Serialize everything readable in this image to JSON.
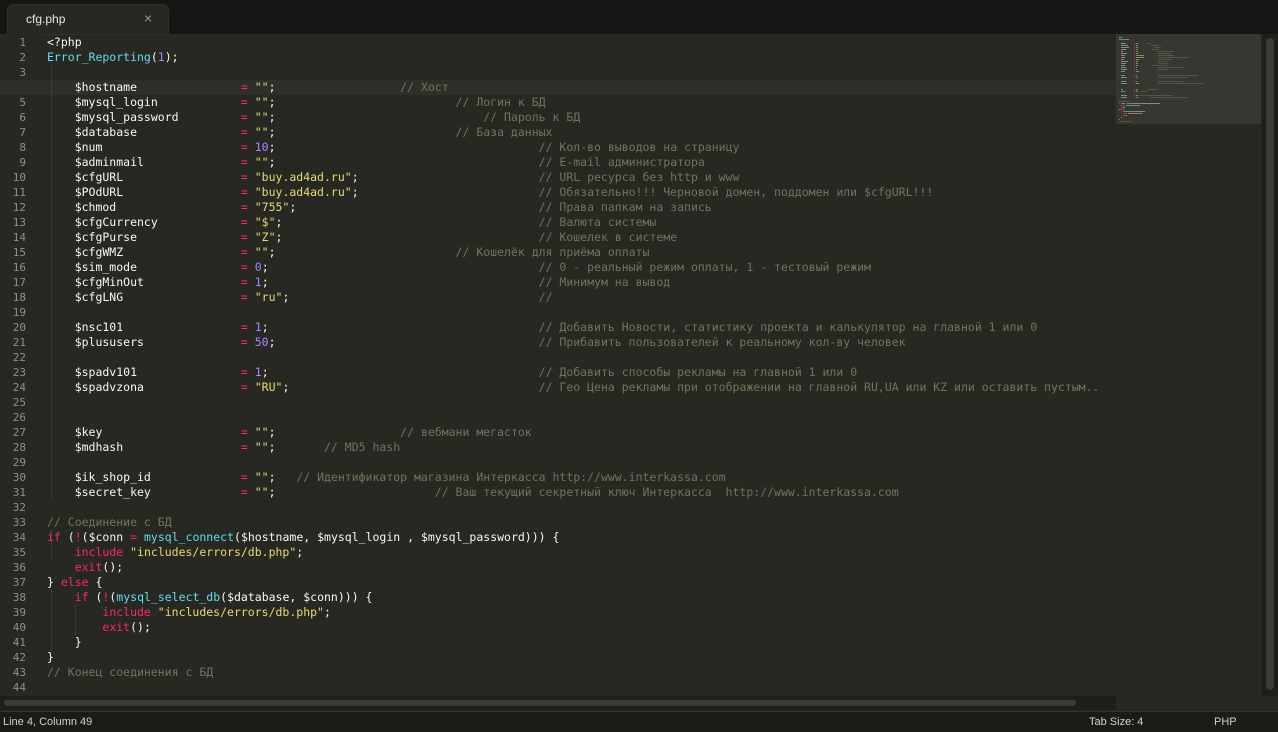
{
  "tab": {
    "title": "cfg.php",
    "close_glyph": "×"
  },
  "status": {
    "position": "Line 4, Column 49",
    "tab_size": "Tab Size: 4",
    "syntax": "PHP"
  },
  "active_line": 4,
  "lines": [
    [
      {
        "t": "<?php",
        "c": "v"
      }
    ],
    [
      {
        "t": "Error_Reporting",
        "c": "f"
      },
      {
        "t": "(",
        "c": "v"
      },
      {
        "t": "1",
        "c": "n"
      },
      {
        "t": ");",
        "c": "v"
      }
    ],
    [],
    [
      {
        "t": "    $hostname               ",
        "c": "v"
      },
      {
        "t": "=",
        "c": "k"
      },
      {
        "t": " ",
        "c": "v"
      },
      {
        "t": "\"\"",
        "c": "s"
      },
      {
        "t": ";                  ",
        "c": "v"
      },
      {
        "t": "// Хост",
        "c": "c"
      }
    ],
    [
      {
        "t": "    $mysql_login            ",
        "c": "v"
      },
      {
        "t": "=",
        "c": "k"
      },
      {
        "t": " ",
        "c": "v"
      },
      {
        "t": "\"\"",
        "c": "s"
      },
      {
        "t": ";                          ",
        "c": "v"
      },
      {
        "t": "// Логин к БД",
        "c": "c"
      }
    ],
    [
      {
        "t": "    $mysql_password         ",
        "c": "v"
      },
      {
        "t": "=",
        "c": "k"
      },
      {
        "t": " ",
        "c": "v"
      },
      {
        "t": "\"\"",
        "c": "s"
      },
      {
        "t": ";                              ",
        "c": "v"
      },
      {
        "t": "// Пароль к БД",
        "c": "c"
      }
    ],
    [
      {
        "t": "    $database               ",
        "c": "v"
      },
      {
        "t": "=",
        "c": "k"
      },
      {
        "t": " ",
        "c": "v"
      },
      {
        "t": "\"\"",
        "c": "s"
      },
      {
        "t": ";                          ",
        "c": "v"
      },
      {
        "t": "// База данных",
        "c": "c"
      }
    ],
    [
      {
        "t": "    $num                    ",
        "c": "v"
      },
      {
        "t": "=",
        "c": "k"
      },
      {
        "t": " ",
        "c": "v"
      },
      {
        "t": "10",
        "c": "n"
      },
      {
        "t": ";                                      ",
        "c": "v"
      },
      {
        "t": "// Кол-во выводов на страницу",
        "c": "c"
      }
    ],
    [
      {
        "t": "    $adminmail              ",
        "c": "v"
      },
      {
        "t": "=",
        "c": "k"
      },
      {
        "t": " ",
        "c": "v"
      },
      {
        "t": "\"\"",
        "c": "s"
      },
      {
        "t": ";                                      ",
        "c": "v"
      },
      {
        "t": "// E-mail администратора",
        "c": "c"
      }
    ],
    [
      {
        "t": "    $cfgURL                 ",
        "c": "v"
      },
      {
        "t": "=",
        "c": "k"
      },
      {
        "t": " ",
        "c": "v"
      },
      {
        "t": "\"buy.ad4ad.ru\"",
        "c": "s"
      },
      {
        "t": ";                          ",
        "c": "v"
      },
      {
        "t": "// URL ресурса без http и www",
        "c": "c"
      }
    ],
    [
      {
        "t": "    $POdURL                 ",
        "c": "v"
      },
      {
        "t": "=",
        "c": "k"
      },
      {
        "t": " ",
        "c": "v"
      },
      {
        "t": "\"buy.ad4ad.ru\"",
        "c": "s"
      },
      {
        "t": ";                          ",
        "c": "v"
      },
      {
        "t": "// Обязательно!!! Черновой домен, поддомен или $cfgURL!!!",
        "c": "c"
      }
    ],
    [
      {
        "t": "    $chmod                  ",
        "c": "v"
      },
      {
        "t": "=",
        "c": "k"
      },
      {
        "t": " ",
        "c": "v"
      },
      {
        "t": "\"755\"",
        "c": "s"
      },
      {
        "t": ";                                   ",
        "c": "v"
      },
      {
        "t": "// Права папкам на запись",
        "c": "c"
      }
    ],
    [
      {
        "t": "    $cfgCurrency            ",
        "c": "v"
      },
      {
        "t": "=",
        "c": "k"
      },
      {
        "t": " ",
        "c": "v"
      },
      {
        "t": "\"$\"",
        "c": "s"
      },
      {
        "t": ";                                     ",
        "c": "v"
      },
      {
        "t": "// Валюта системы",
        "c": "c"
      }
    ],
    [
      {
        "t": "    $cfgPurse               ",
        "c": "v"
      },
      {
        "t": "=",
        "c": "k"
      },
      {
        "t": " ",
        "c": "v"
      },
      {
        "t": "\"Z\"",
        "c": "s"
      },
      {
        "t": ";                                     ",
        "c": "v"
      },
      {
        "t": "// Кошелек в системе",
        "c": "c"
      }
    ],
    [
      {
        "t": "    $cfgWMZ                 ",
        "c": "v"
      },
      {
        "t": "=",
        "c": "k"
      },
      {
        "t": " ",
        "c": "v"
      },
      {
        "t": "\"\"",
        "c": "s"
      },
      {
        "t": ";                          ",
        "c": "v"
      },
      {
        "t": "// Кошелёк для приёма оплаты",
        "c": "c"
      }
    ],
    [
      {
        "t": "    $sim_mode               ",
        "c": "v"
      },
      {
        "t": "=",
        "c": "k"
      },
      {
        "t": " ",
        "c": "v"
      },
      {
        "t": "0",
        "c": "n"
      },
      {
        "t": ";                                       ",
        "c": "v"
      },
      {
        "t": "// 0 - реальный режим оплаты, 1 - тестовый режим",
        "c": "c"
      }
    ],
    [
      {
        "t": "    $cfgMinOut              ",
        "c": "v"
      },
      {
        "t": "=",
        "c": "k"
      },
      {
        "t": " ",
        "c": "v"
      },
      {
        "t": "1",
        "c": "n"
      },
      {
        "t": ";                                       ",
        "c": "v"
      },
      {
        "t": "// Минимум на вывод",
        "c": "c"
      }
    ],
    [
      {
        "t": "    $cfgLNG                 ",
        "c": "v"
      },
      {
        "t": "=",
        "c": "k"
      },
      {
        "t": " ",
        "c": "v"
      },
      {
        "t": "\"ru\"",
        "c": "s"
      },
      {
        "t": ";                                    ",
        "c": "v"
      },
      {
        "t": "//",
        "c": "c"
      }
    ],
    [],
    [
      {
        "t": "    $nsc101                 ",
        "c": "v"
      },
      {
        "t": "=",
        "c": "k"
      },
      {
        "t": " ",
        "c": "v"
      },
      {
        "t": "1",
        "c": "n"
      },
      {
        "t": ";                                       ",
        "c": "v"
      },
      {
        "t": "// Добавить Новости, статистику проекта и калькулятор на главной 1 или 0",
        "c": "c"
      }
    ],
    [
      {
        "t": "    $plususers              ",
        "c": "v"
      },
      {
        "t": "=",
        "c": "k"
      },
      {
        "t": " ",
        "c": "v"
      },
      {
        "t": "50",
        "c": "n"
      },
      {
        "t": ";                                      ",
        "c": "v"
      },
      {
        "t": "// Прибавить пользователей к реальному кол-ву человек",
        "c": "c"
      }
    ],
    [],
    [
      {
        "t": "    $spadv101               ",
        "c": "v"
      },
      {
        "t": "=",
        "c": "k"
      },
      {
        "t": " ",
        "c": "v"
      },
      {
        "t": "1",
        "c": "n"
      },
      {
        "t": ";                                       ",
        "c": "v"
      },
      {
        "t": "// Добавить способы рекламы на главной 1 или 0",
        "c": "c"
      }
    ],
    [
      {
        "t": "    $spadvzona              ",
        "c": "v"
      },
      {
        "t": "=",
        "c": "k"
      },
      {
        "t": " ",
        "c": "v"
      },
      {
        "t": "\"RU\"",
        "c": "s"
      },
      {
        "t": ";                                    ",
        "c": "v"
      },
      {
        "t": "// Гео Цена рекламы при отображении на главной RU,UA или KZ или оставить пустым..",
        "c": "c"
      }
    ],
    [],
    [],
    [
      {
        "t": "    $key                    ",
        "c": "v"
      },
      {
        "t": "=",
        "c": "k"
      },
      {
        "t": " ",
        "c": "v"
      },
      {
        "t": "\"\"",
        "c": "s"
      },
      {
        "t": ";                  ",
        "c": "v"
      },
      {
        "t": "// вебмани мегасток",
        "c": "c"
      }
    ],
    [
      {
        "t": "    $mdhash                 ",
        "c": "v"
      },
      {
        "t": "=",
        "c": "k"
      },
      {
        "t": " ",
        "c": "v"
      },
      {
        "t": "\"\"",
        "c": "s"
      },
      {
        "t": ";       ",
        "c": "v"
      },
      {
        "t": "// MD5 hash",
        "c": "c"
      }
    ],
    [],
    [
      {
        "t": "    $ik_shop_id             ",
        "c": "v"
      },
      {
        "t": "=",
        "c": "k"
      },
      {
        "t": " ",
        "c": "v"
      },
      {
        "t": "\"\"",
        "c": "s"
      },
      {
        "t": ";   ",
        "c": "v"
      },
      {
        "t": "// Идентификатор магазина Интеркасса http://www.interkassa.com",
        "c": "c"
      }
    ],
    [
      {
        "t": "    $secret_key             ",
        "c": "v"
      },
      {
        "t": "=",
        "c": "k"
      },
      {
        "t": " ",
        "c": "v"
      },
      {
        "t": "\"\"",
        "c": "s"
      },
      {
        "t": ";                       ",
        "c": "v"
      },
      {
        "t": "// Ваш текущий секретный ключ Интеркасса  http://www.interkassa.com",
        "c": "c"
      }
    ],
    [],
    [
      {
        "t": "// Соединение с БД",
        "c": "c"
      }
    ],
    [
      {
        "t": "if",
        "c": "k"
      },
      {
        "t": " (",
        "c": "v"
      },
      {
        "t": "!",
        "c": "k"
      },
      {
        "t": "($conn ",
        "c": "v"
      },
      {
        "t": "=",
        "c": "k"
      },
      {
        "t": " ",
        "c": "v"
      },
      {
        "t": "mysql_connect",
        "c": "f"
      },
      {
        "t": "($hostname, $mysql_login , $mysql_password))) {",
        "c": "v"
      }
    ],
    [
      {
        "t": "    ",
        "c": "v"
      },
      {
        "t": "include",
        "c": "k"
      },
      {
        "t": " ",
        "c": "v"
      },
      {
        "t": "\"includes/errors/db.php\"",
        "c": "s"
      },
      {
        "t": ";",
        "c": "v"
      }
    ],
    [
      {
        "t": "    ",
        "c": "v"
      },
      {
        "t": "exit",
        "c": "k"
      },
      {
        "t": "();",
        "c": "v"
      }
    ],
    [
      {
        "t": "} ",
        "c": "v"
      },
      {
        "t": "else",
        "c": "k"
      },
      {
        "t": " {",
        "c": "v"
      }
    ],
    [
      {
        "t": "    ",
        "c": "v"
      },
      {
        "t": "if",
        "c": "k"
      },
      {
        "t": " (",
        "c": "v"
      },
      {
        "t": "!",
        "c": "k"
      },
      {
        "t": "(",
        "c": "v"
      },
      {
        "t": "mysql_select_db",
        "c": "f"
      },
      {
        "t": "($database, $conn))) {",
        "c": "v"
      }
    ],
    [
      {
        "t": "        ",
        "c": "v"
      },
      {
        "t": "include",
        "c": "k"
      },
      {
        "t": " ",
        "c": "v"
      },
      {
        "t": "\"includes/errors/db.php\"",
        "c": "s"
      },
      {
        "t": ";",
        "c": "v"
      }
    ],
    [
      {
        "t": "        ",
        "c": "v"
      },
      {
        "t": "exit",
        "c": "k"
      },
      {
        "t": "();",
        "c": "v"
      }
    ],
    [
      {
        "t": "    }",
        "c": "v"
      }
    ],
    [
      {
        "t": "}",
        "c": "v"
      }
    ],
    [
      {
        "t": "// Конец соединения с БД",
        "c": "c"
      }
    ],
    []
  ]
}
